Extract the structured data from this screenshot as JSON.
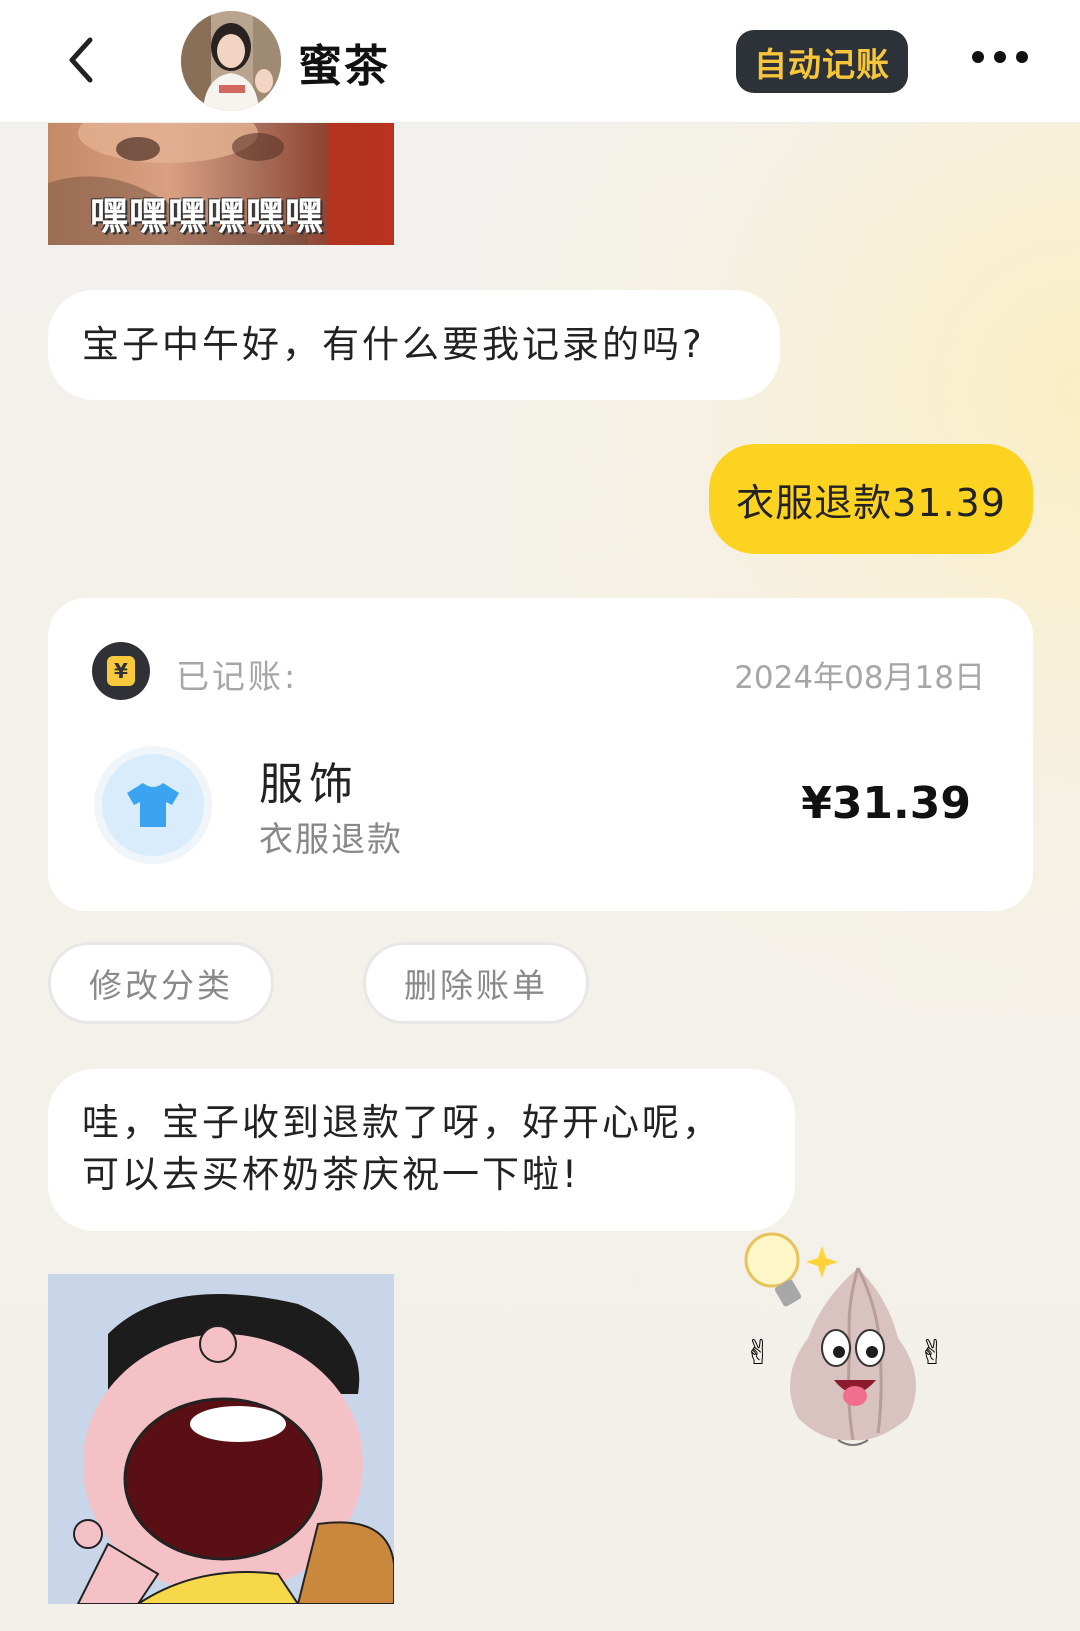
{
  "header": {
    "back_icon": "chevron-left-icon",
    "contact_name": "蜜茶",
    "auto_record_label": "自动记账",
    "more_icon": "more-dots-icon"
  },
  "messages": {
    "meme_top_caption": "嘿嘿嘿嘿嘿嘿",
    "greeting": "宝子中午好，有什么要我记录的吗?",
    "user_message": "衣服退款31.39",
    "reply_line1": "哇，宝子收到退款了呀，好开心呢，",
    "reply_line2": "可以去买杯奶茶庆祝一下啦!"
  },
  "record_card": {
    "coin_icon": "yuan-coin-icon",
    "status_label": "已记账:",
    "date": "2024年08月18日",
    "category_icon": "tshirt-icon",
    "category": "服饰",
    "note": "衣服退款",
    "amount": "¥31.39"
  },
  "actions": {
    "edit_category": "修改分类",
    "delete_bill": "删除账单"
  },
  "colors": {
    "accent_yellow": "#fdd322",
    "dark_button": "#2d3138",
    "button_text": "#f8c63a",
    "category_blue": "#3aa3f2"
  }
}
